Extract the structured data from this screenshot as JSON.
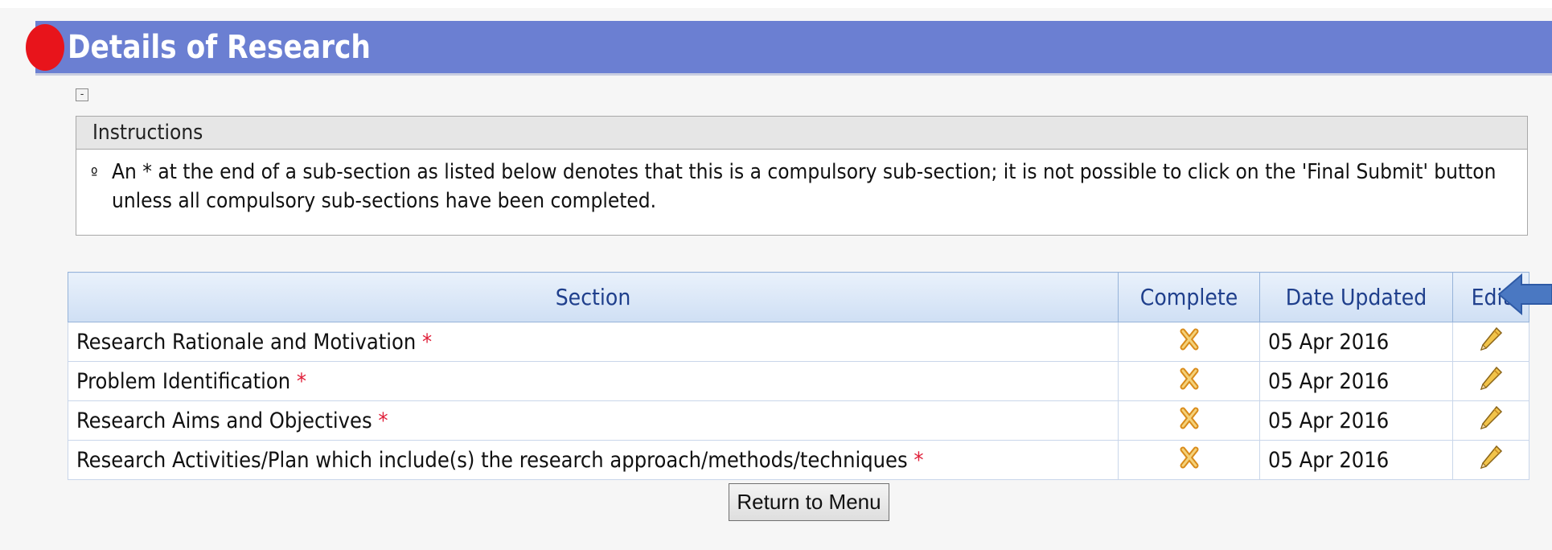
{
  "header": {
    "title": "Details of Research"
  },
  "collapse_toggle": {
    "symbol": "-"
  },
  "instructions": {
    "title": "Instructions",
    "bullet": "º",
    "text": "An * at the end of a sub-section as listed below denotes that this is a compulsory sub-section; it is not possible to click on the 'Final Submit' button unless all compulsory sub-sections have been completed."
  },
  "table": {
    "headers": [
      "Section",
      "Complete",
      "Date Updated",
      "Edit"
    ],
    "rows": [
      {
        "section": "Research Rationale and Motivation",
        "required": "*",
        "complete_icon": "cross-icon",
        "date": "05 Apr 2016",
        "edit_icon": "pencil-icon"
      },
      {
        "section": "Problem Identification",
        "required": "*",
        "complete_icon": "cross-icon",
        "date": "05 Apr 2016",
        "edit_icon": "pencil-icon"
      },
      {
        "section": "Research Aims and Objectives",
        "required": "*",
        "complete_icon": "cross-icon",
        "date": "05 Apr 2016",
        "edit_icon": "pencil-icon"
      },
      {
        "section": "Research Activities/Plan which include(s) the research approach/methods/techniques",
        "required": "*",
        "complete_icon": "cross-icon",
        "date": "05 Apr 2016",
        "edit_icon": "pencil-icon"
      }
    ]
  },
  "buttons": {
    "return_label": "Return to Menu"
  },
  "colors": {
    "header_bg": "#6b7fd2",
    "header_dot": "#e8141b",
    "required_mark": "#e0203a",
    "table_header_text": "#1f3f8c",
    "arrow": "#4a78c2"
  }
}
